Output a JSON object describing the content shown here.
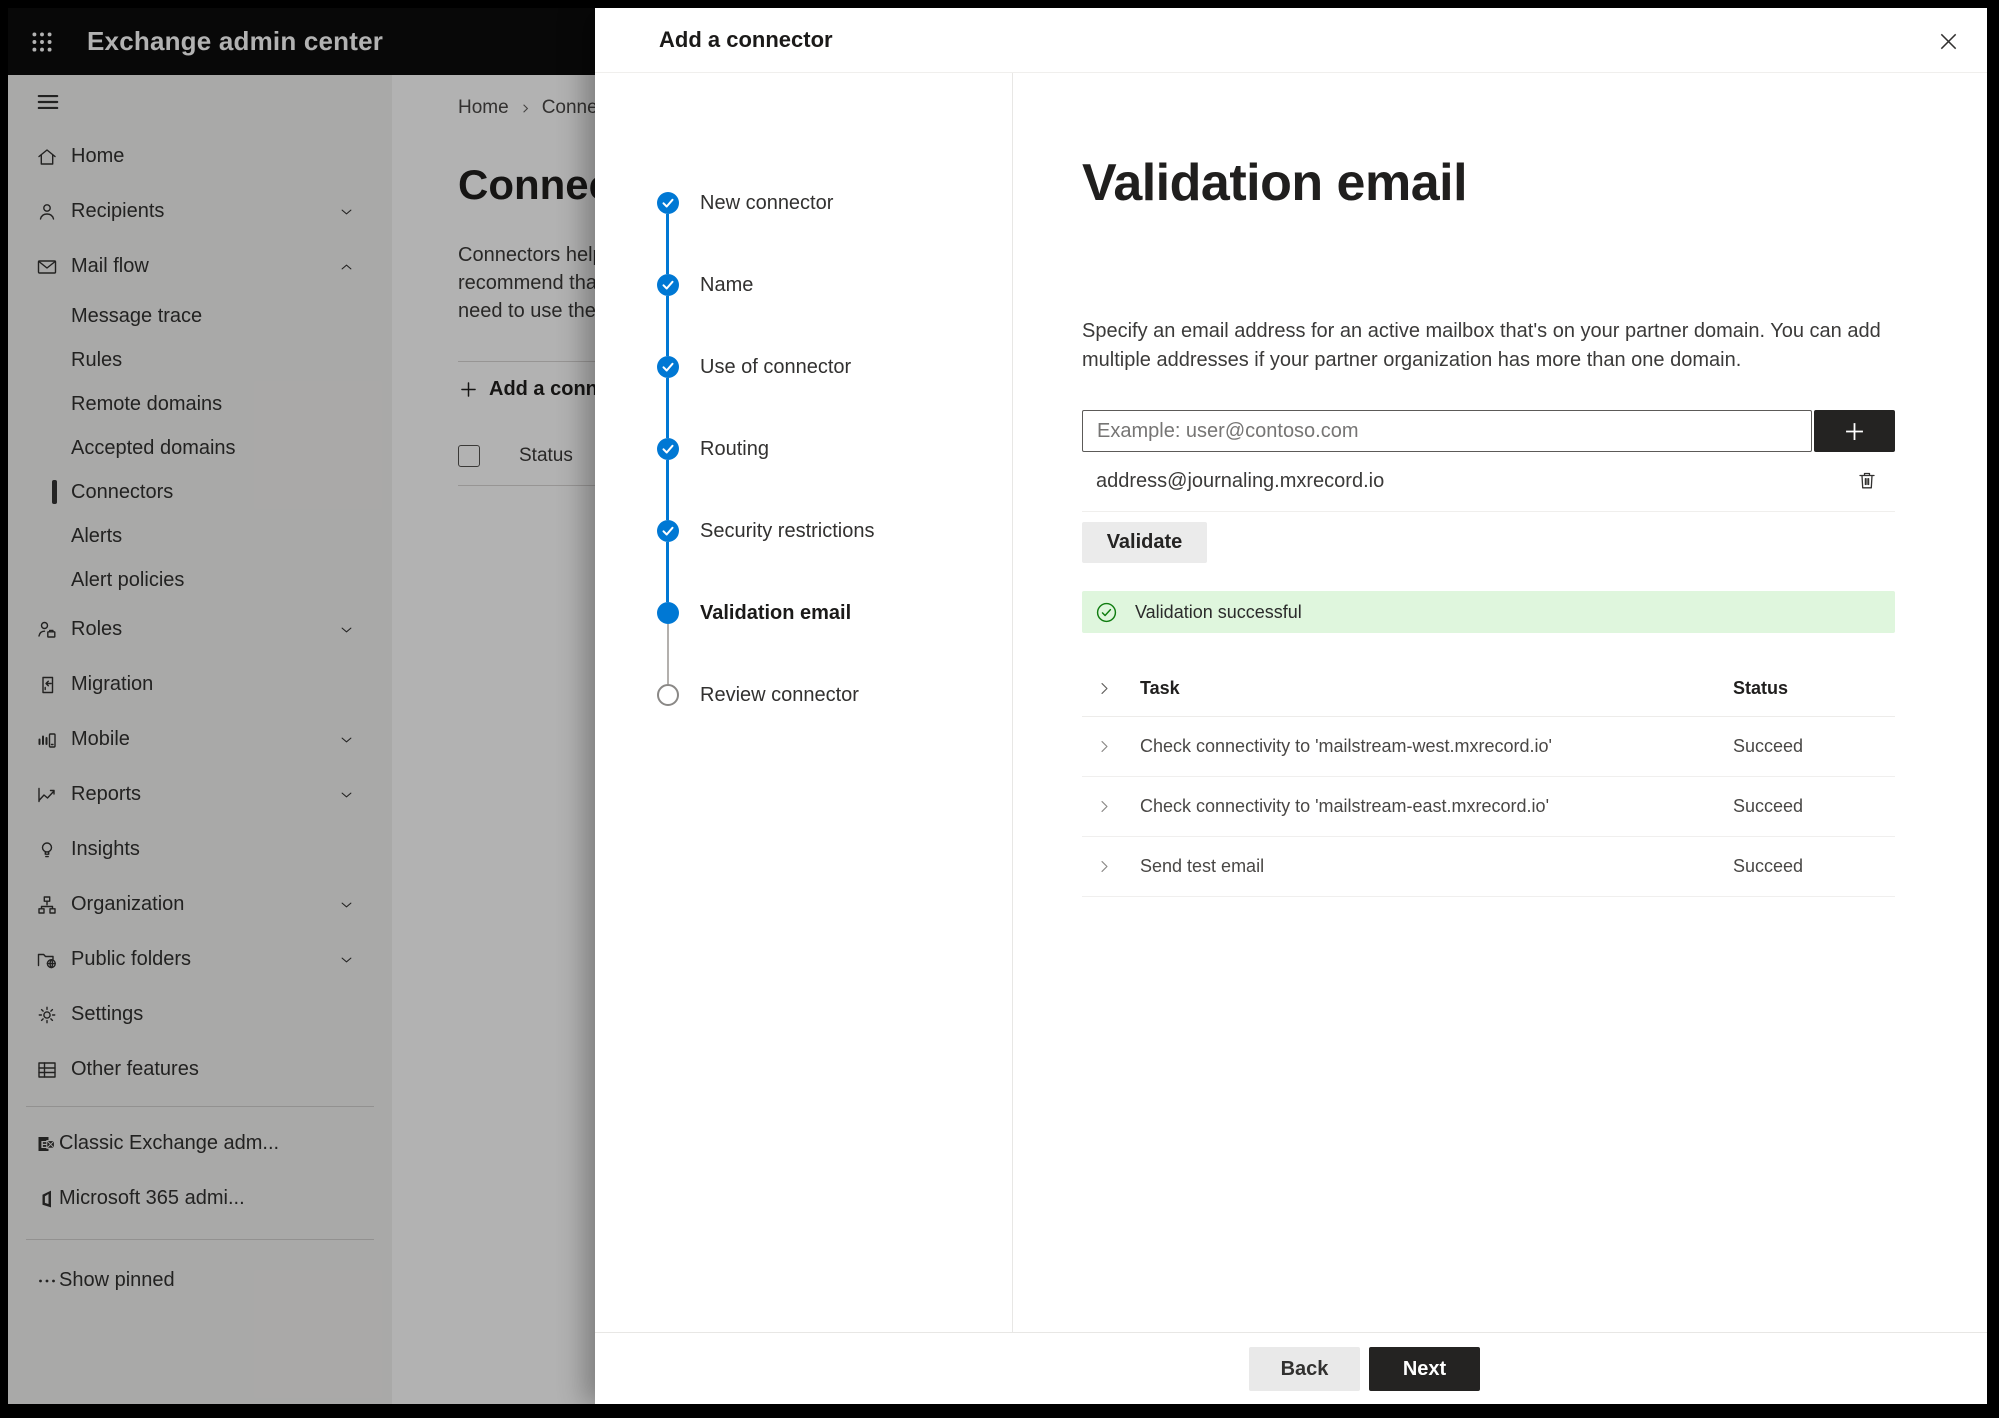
{
  "topbar": {
    "title": "Exchange admin center"
  },
  "sidebar": {
    "items": [
      {
        "label": "Home"
      },
      {
        "label": "Recipients"
      },
      {
        "label": "Mail flow"
      },
      {
        "label": "Message trace"
      },
      {
        "label": "Rules"
      },
      {
        "label": "Remote domains"
      },
      {
        "label": "Accepted domains"
      },
      {
        "label": "Connectors"
      },
      {
        "label": "Alerts"
      },
      {
        "label": "Alert policies"
      },
      {
        "label": "Roles"
      },
      {
        "label": "Migration"
      },
      {
        "label": "Mobile"
      },
      {
        "label": "Reports"
      },
      {
        "label": "Insights"
      },
      {
        "label": "Organization"
      },
      {
        "label": "Public folders"
      },
      {
        "label": "Settings"
      },
      {
        "label": "Other features"
      },
      {
        "label": "Classic Exchange adm..."
      },
      {
        "label": "Microsoft 365 admi..."
      },
      {
        "label": "Show pinned"
      }
    ]
  },
  "background": {
    "breadcrumb_home": "Home",
    "breadcrumb_current": "Conne",
    "title": "Connec",
    "line1": "Connectors help",
    "line2": "recommend that",
    "line3": "need to use ther",
    "add_button": "Add a conn",
    "status_header": "Status"
  },
  "wizard": {
    "title": "Add a connector",
    "steps": [
      {
        "label": "New connector",
        "state": "done"
      },
      {
        "label": "Name",
        "state": "done"
      },
      {
        "label": "Use of connector",
        "state": "done"
      },
      {
        "label": "Routing",
        "state": "done"
      },
      {
        "label": "Security restrictions",
        "state": "done"
      },
      {
        "label": "Validation email",
        "state": "current"
      },
      {
        "label": "Review connector",
        "state": "upcoming"
      }
    ],
    "page": {
      "heading": "Validation email",
      "description": "Specify an email address for an active mailbox that's on your partner domain. You can add multiple addresses if your partner organization has more than one domain.",
      "email_placeholder": "Example: user@contoso.com",
      "added_address": "address@journaling.mxrecord.io",
      "validate_button": "Validate",
      "banner_text": "Validation successful",
      "table": {
        "col_task": "Task",
        "col_status": "Status",
        "rows": [
          {
            "task": "Check connectivity to 'mailstream-west.mxrecord.io'",
            "status": "Succeed"
          },
          {
            "task": "Check connectivity to 'mailstream-east.mxrecord.io'",
            "status": "Succeed"
          },
          {
            "task": "Send test email",
            "status": "Succeed"
          }
        ]
      }
    },
    "footer": {
      "back": "Back",
      "next": "Next"
    }
  },
  "colors": {
    "accent_blue": "#0078d4",
    "success_green": "#107c10",
    "banner_green_bg": "#dff6dd",
    "topbar_bg": "#0c0c0c"
  }
}
